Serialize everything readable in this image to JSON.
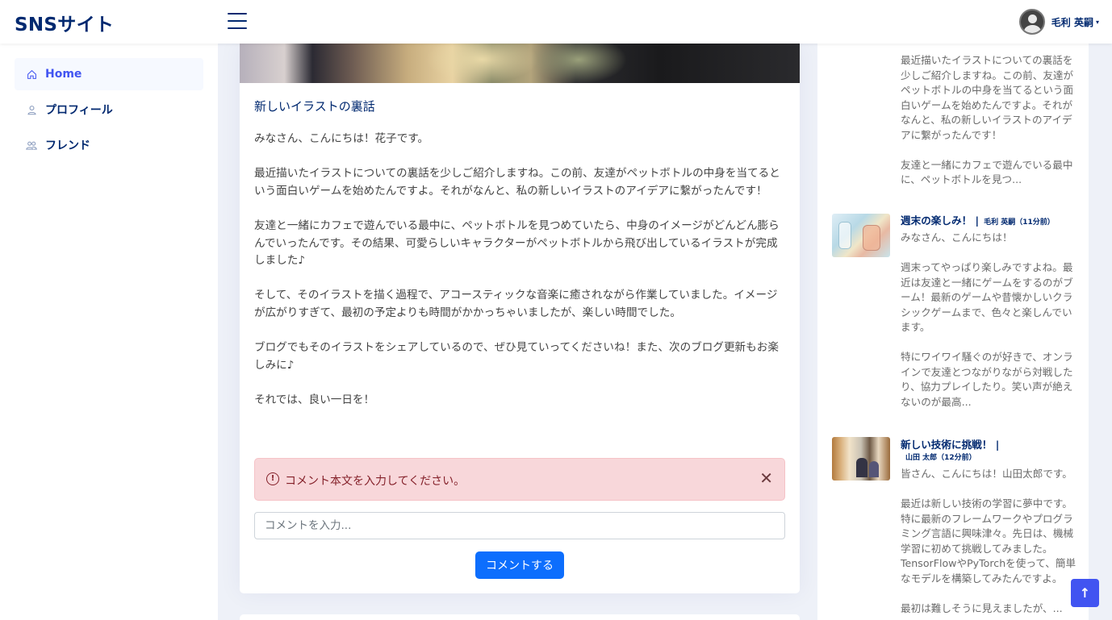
{
  "header": {
    "brand": "SNSサイト",
    "user_name": "毛利 英嗣",
    "caret": "▾"
  },
  "sidebar": {
    "items": [
      {
        "label": "Home",
        "icon": "home-icon"
      },
      {
        "label": "プロフィール",
        "icon": "person-icon"
      },
      {
        "label": "フレンド",
        "icon": "people-icon"
      }
    ]
  },
  "post": {
    "title": "新しいイラストの裏話",
    "paragraphs": [
      "みなさん、こんにちは！花子です。",
      "最近描いたイラストについての裏話を少しご紹介しますね。この前、友達がペットボトルの中身を当てるという面白いゲームを始めたんですよ。それがなんと、私の新しいイラストのアイデアに繋がったんです！",
      "友達と一緒にカフェで遊んでいる最中に、ペットボトルを見つめていたら、中身のイメージがどんどん膨らんでいったんです。その結果、可愛らしいキャラクターがペットボトルから飛び出しているイラストが完成しました♪",
      "そして、そのイラストを描く過程で、アコースティックな音楽に癒されながら作業していました。イメージが広がりすぎて、最初の予定よりも時間がかかっちゃいましたが、楽しい時間でした。",
      "ブログでもそのイラストをシェアしているので、ぜひ見ていってくださいね！また、次のブログ更新もお楽しみに♪",
      "それでは、良い一日を！"
    ],
    "alert_text": "コメント本文を入力してください。",
    "alert_icon": "!",
    "alert_close": "✕",
    "comment_placeholder": "コメントを入力...",
    "comment_button": "コメントする"
  },
  "right_panel": {
    "top_excerpt": [
      "最近描いたイラストについての裏話を少しご紹介しますね。この前、友達がペットボトルの中身を当てるという面白いゲームを始めたんですよ。それがなんと、私の新しいイラストのアイデアに繋がったんです！",
      "友達と一緒にカフェで遊んでいる最中に、ペットボトルを見つ..."
    ],
    "posts": [
      {
        "title": "週末の楽しみ！ |",
        "meta": "毛利 英嗣（11分前）",
        "excerpt": [
          "みなさん、こんにちは！",
          "週末ってやっぱり楽しみですよね。最近は友達と一緒にゲームをするのがブーム！最新のゲームや昔懐かしいクラシックゲームまで、色々と楽しんでいます。",
          "特にワイワイ騒ぐのが好きで、オンラインで友達とつながりながら対戦したり、協力プレイしたり。笑い声が絶えないのが最高..."
        ]
      },
      {
        "title": "新しい技術に挑戦！ |",
        "meta": "山田 太郎（12分前）",
        "excerpt": [
          "皆さん、こんにちは！山田太郎です。",
          "最近は新しい技術の学習に夢中です。特に最新のフレームワークやプログラミング言語に興味津々。先日は、機械学習に初めて挑戦してみました。TensorFlowやPyTorchを使って、簡単なモデルを構築してみたんですよ。",
          "最初は難しそうに見えましたが、..."
        ]
      }
    ]
  },
  "scroll_top_icon": "↑"
}
